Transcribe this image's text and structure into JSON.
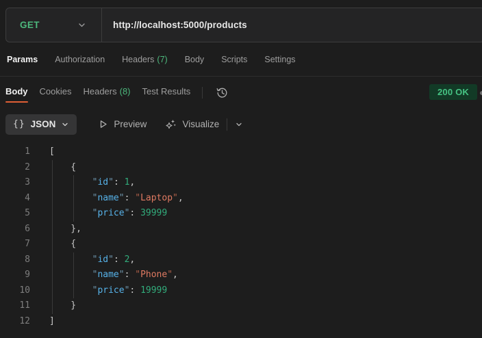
{
  "colors": {
    "bg": "#1d1d1d",
    "green": "#4db97d",
    "green_bright": "#46c383",
    "orange": "#e05f35",
    "status_bg": "#123a26",
    "code_key": "#57b3ea",
    "code_str": "#e07a62",
    "code_num": "#32ad7c"
  },
  "request_bar": {
    "method": "GET",
    "url": "http://localhost:5000/products"
  },
  "request_tabs": [
    {
      "label": "Params",
      "active": true
    },
    {
      "label": "Authorization"
    },
    {
      "label": "Headers",
      "count": "(7)"
    },
    {
      "label": "Body"
    },
    {
      "label": "Scripts"
    },
    {
      "label": "Settings"
    }
  ],
  "response_tabs": [
    {
      "label": "Body",
      "active": true
    },
    {
      "label": "Cookies"
    },
    {
      "label": "Headers",
      "count": "(8)"
    },
    {
      "label": "Test Results"
    }
  ],
  "response_meta": {
    "status_text": "200 OK"
  },
  "toolbar": {
    "format_icon": "{}",
    "format_label": "JSON",
    "preview_label": "Preview",
    "visualize_label": "Visualize"
  },
  "icons": {
    "method_chevron": "chevron-down-icon",
    "history": "history-clock-icon",
    "preview": "play-outline-icon",
    "visualize": "sparkles-icon"
  },
  "code": {
    "language": "json",
    "lines": [
      {
        "no": "1",
        "guides": 0,
        "tokens": [
          [
            "p",
            "["
          ]
        ]
      },
      {
        "no": "2",
        "guides": 1,
        "tokens": [
          [
            "p",
            "    {"
          ]
        ]
      },
      {
        "no": "3",
        "guides": 2,
        "tokens": [
          [
            "p",
            "        "
          ],
          [
            "kq",
            "\""
          ],
          [
            "k",
            "id"
          ],
          [
            "kq",
            "\""
          ],
          [
            "p",
            ": "
          ],
          [
            "n",
            "1"
          ],
          [
            "p",
            ","
          ]
        ]
      },
      {
        "no": "4",
        "guides": 2,
        "tokens": [
          [
            "p",
            "        "
          ],
          [
            "kq",
            "\""
          ],
          [
            "k",
            "name"
          ],
          [
            "kq",
            "\""
          ],
          [
            "p",
            ": "
          ],
          [
            "sq",
            "\""
          ],
          [
            "s",
            "Laptop"
          ],
          [
            "sq",
            "\""
          ],
          [
            "p",
            ","
          ]
        ]
      },
      {
        "no": "5",
        "guides": 2,
        "tokens": [
          [
            "p",
            "        "
          ],
          [
            "kq",
            "\""
          ],
          [
            "k",
            "price"
          ],
          [
            "kq",
            "\""
          ],
          [
            "p",
            ": "
          ],
          [
            "n",
            "39999"
          ]
        ]
      },
      {
        "no": "6",
        "guides": 1,
        "tokens": [
          [
            "p",
            "    },"
          ]
        ]
      },
      {
        "no": "7",
        "guides": 1,
        "tokens": [
          [
            "p",
            "    {"
          ]
        ]
      },
      {
        "no": "8",
        "guides": 2,
        "tokens": [
          [
            "p",
            "        "
          ],
          [
            "kq",
            "\""
          ],
          [
            "k",
            "id"
          ],
          [
            "kq",
            "\""
          ],
          [
            "p",
            ": "
          ],
          [
            "n",
            "2"
          ],
          [
            "p",
            ","
          ]
        ]
      },
      {
        "no": "9",
        "guides": 2,
        "tokens": [
          [
            "p",
            "        "
          ],
          [
            "kq",
            "\""
          ],
          [
            "k",
            "name"
          ],
          [
            "kq",
            "\""
          ],
          [
            "p",
            ": "
          ],
          [
            "sq",
            "\""
          ],
          [
            "s",
            "Phone"
          ],
          [
            "sq",
            "\""
          ],
          [
            "p",
            ","
          ]
        ]
      },
      {
        "no": "10",
        "guides": 2,
        "tokens": [
          [
            "p",
            "        "
          ],
          [
            "kq",
            "\""
          ],
          [
            "k",
            "price"
          ],
          [
            "kq",
            "\""
          ],
          [
            "p",
            ": "
          ],
          [
            "n",
            "19999"
          ]
        ]
      },
      {
        "no": "11",
        "guides": 1,
        "tokens": [
          [
            "p",
            "    }"
          ]
        ]
      },
      {
        "no": "12",
        "guides": 0,
        "tokens": [
          [
            "p",
            "]"
          ]
        ]
      }
    ]
  }
}
